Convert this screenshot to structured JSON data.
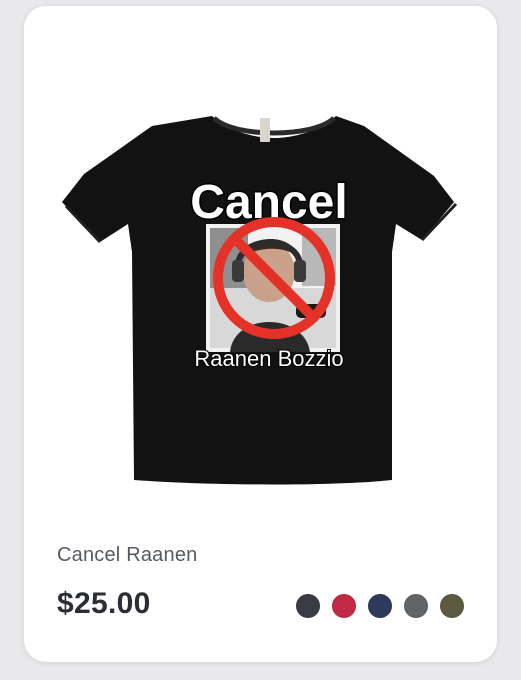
{
  "product": {
    "name": "Cancel Raanen",
    "price": "$25.00",
    "graphic": {
      "headline": "Cancel",
      "caption": "Raanen Bozzio"
    },
    "swatches": [
      {
        "name": "dark-gray",
        "color": "#3a3b44"
      },
      {
        "name": "red",
        "color": "#c02a45"
      },
      {
        "name": "navy",
        "color": "#2e3a5c"
      },
      {
        "name": "gray",
        "color": "#616466"
      },
      {
        "name": "olive",
        "color": "#5d5a40"
      }
    ]
  }
}
